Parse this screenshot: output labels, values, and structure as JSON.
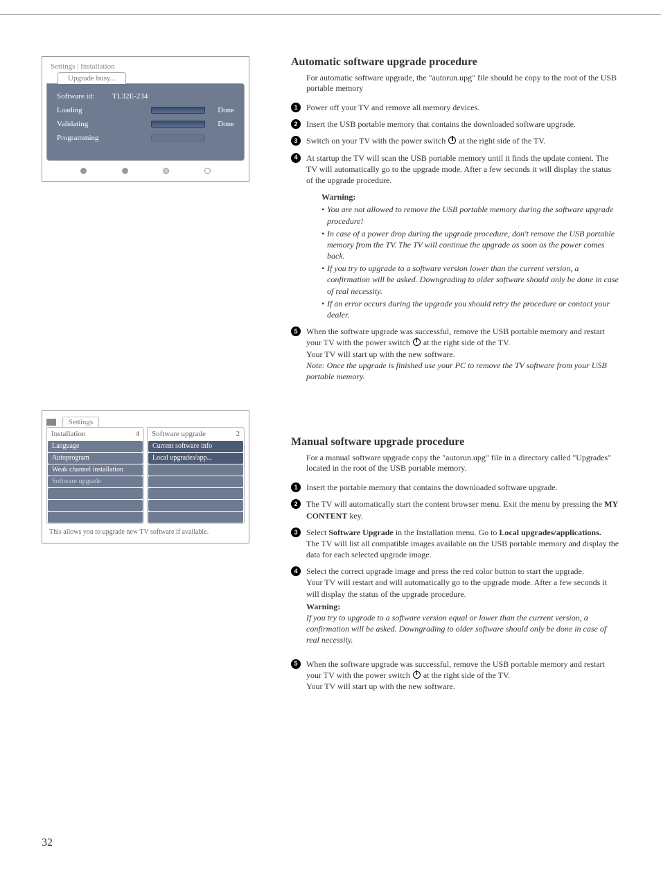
{
  "page_number": "32",
  "fig1": {
    "breadcrumb": "Settings | Installation",
    "tab": "Upgrade busy...",
    "rows": {
      "swid_label": "Software id:",
      "swid_value": "TL32E-234",
      "loading_label": "Loading",
      "loading_status": "Done",
      "validating_label": "Validating",
      "validating_status": "Done",
      "programming_label": "Programming",
      "programming_status": ""
    }
  },
  "fig2": {
    "title": "Settings",
    "left_header_label": "Installation",
    "left_header_num": "4",
    "left_items": [
      "Language",
      "Autoprogram",
      "Weak channel installation",
      "Software upgrade"
    ],
    "right_header_label": "Software upgrade",
    "right_header_num": "2",
    "right_items": [
      "Current software info",
      "Local upgrades/app..."
    ],
    "help": "This allows you to upgrade new TV software if available."
  },
  "auto": {
    "heading": "Automatic software upgrade procedure",
    "intro": "For automatic software upgrade, the \"autorun.upg\" file should be copy to the root of the USB portable memory",
    "step1": "Power off your TV and remove all memory devices.",
    "step2": "Insert the USB portable memory that contains the downloaded software upgrade.",
    "step3_a": "Switch on your TV with the power switch ",
    "step3_b": " at the right side of the TV.",
    "step4": "At startup the TV will scan the USB portable memory until it finds the update content. The TV will automatically go to the upgrade mode. After a few seconds it will display the status of the upgrade procedure.",
    "warning_title": "Warning:",
    "warn1": "You are not allowed to remove the USB portable memory during the software upgrade procedure!",
    "warn2": "In case of a power drop during the upgrade procedure, don't remove the USB portable memory from the TV. The TV will continue the upgrade as soon as the power comes back.",
    "warn3": "If you try to upgrade to a software version lower than the current version, a confirmation will be asked. Downgrading to older software should only be done in case of real necessity.",
    "warn4": "If an error occurs during the upgrade you should retry the procedure or contact your dealer.",
    "step5_a": "When the software upgrade was successful, remove the USB portable memory and restart your TV with the power switch ",
    "step5_b": " at the right side of the TV.",
    "step5_c": "Your TV will start up with the new software.",
    "step5_note": "Note: Once the upgrade is finished use your PC to remove the TV software from your USB portable memory."
  },
  "manual": {
    "heading": "Manual software upgrade procedure",
    "intro": "For a manual software upgrade copy the \"autorun.upg\" file in a directory called \"Upgrades\" located in the root of the USB portable memory.",
    "step1": "Insert the portable memory that contains the downloaded software upgrade.",
    "step2_a": "The TV will automatically start the content browser menu. Exit the menu by pressing the ",
    "step2_key": "MY CONTENT",
    "step2_b": " key.",
    "step3_a": "Select ",
    "step3_b": "Software Upgrade",
    "step3_c": " in the Installation menu. Go to ",
    "step3_d": "Local upgrades/applications.",
    "step3_e": "The TV will list all compatible images available on the USB portable memory and display the data for each selected upgrade image.",
    "step4_a": "Select the correct upgrade image and press the red color button to start the upgrade.",
    "step4_b": "Your TV will restart and will automatically go to the upgrade mode. After a few seconds it will display the status of the upgrade procedure.",
    "step4_warn_title": "Warning:",
    "step4_warn": "If you try to upgrade to a software version equal or lower than the current version, a confirmation will be asked. Downgrading to older software should only be done in case of real necessity.",
    "step5_a": "When the software upgrade was successful, remove the USB portable memory and restart your TV with the power switch ",
    "step5_b": " at the right side of the TV.",
    "step5_c": "Your TV will start up with the new software."
  }
}
